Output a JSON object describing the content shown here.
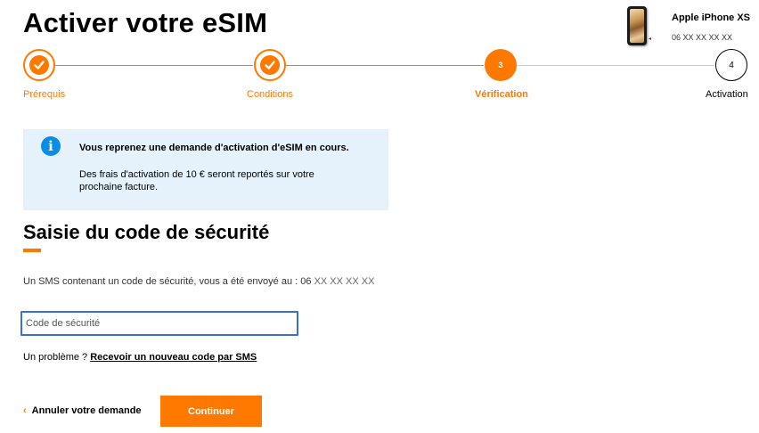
{
  "page": {
    "title": "Activer votre eSIM"
  },
  "device": {
    "name": "Apple iPhone XS",
    "number": "06 XX XX XX XX"
  },
  "stepper": {
    "steps": [
      {
        "number": "1",
        "label": "Prérequis",
        "state": "done"
      },
      {
        "number": "2",
        "label": "Conditions",
        "state": "done"
      },
      {
        "number": "3",
        "label": "Vérification",
        "state": "current"
      },
      {
        "number": "4",
        "label": "Activation",
        "state": "todo"
      }
    ]
  },
  "info": {
    "icon": "info-icon",
    "title": "Vous reprenez une demande d'activation d'eSIM en cours.",
    "text": "Des frais d'activation de 10 € seront reportés sur votre prochaine facture."
  },
  "section": {
    "title": "Saisie du code de sécurité"
  },
  "sms": {
    "text": "Un SMS contenant un code de sécurité, vous a été envoyé au : ",
    "number_prefix": "06",
    "number_masked": "XX XX XX XX"
  },
  "code_input": {
    "placeholder": "Code de sécurité",
    "value": ""
  },
  "problem": {
    "text": "Un problème ? ",
    "link": "Recevoir un nouveau code par SMS"
  },
  "actions": {
    "cancel": "Annuler votre demande",
    "continue": "Continuer"
  },
  "colors": {
    "accent": "#ff7900",
    "info_bg": "#e5f2fb",
    "info_icon": "#0a8de6",
    "focus_border": "#3a6ed8"
  }
}
